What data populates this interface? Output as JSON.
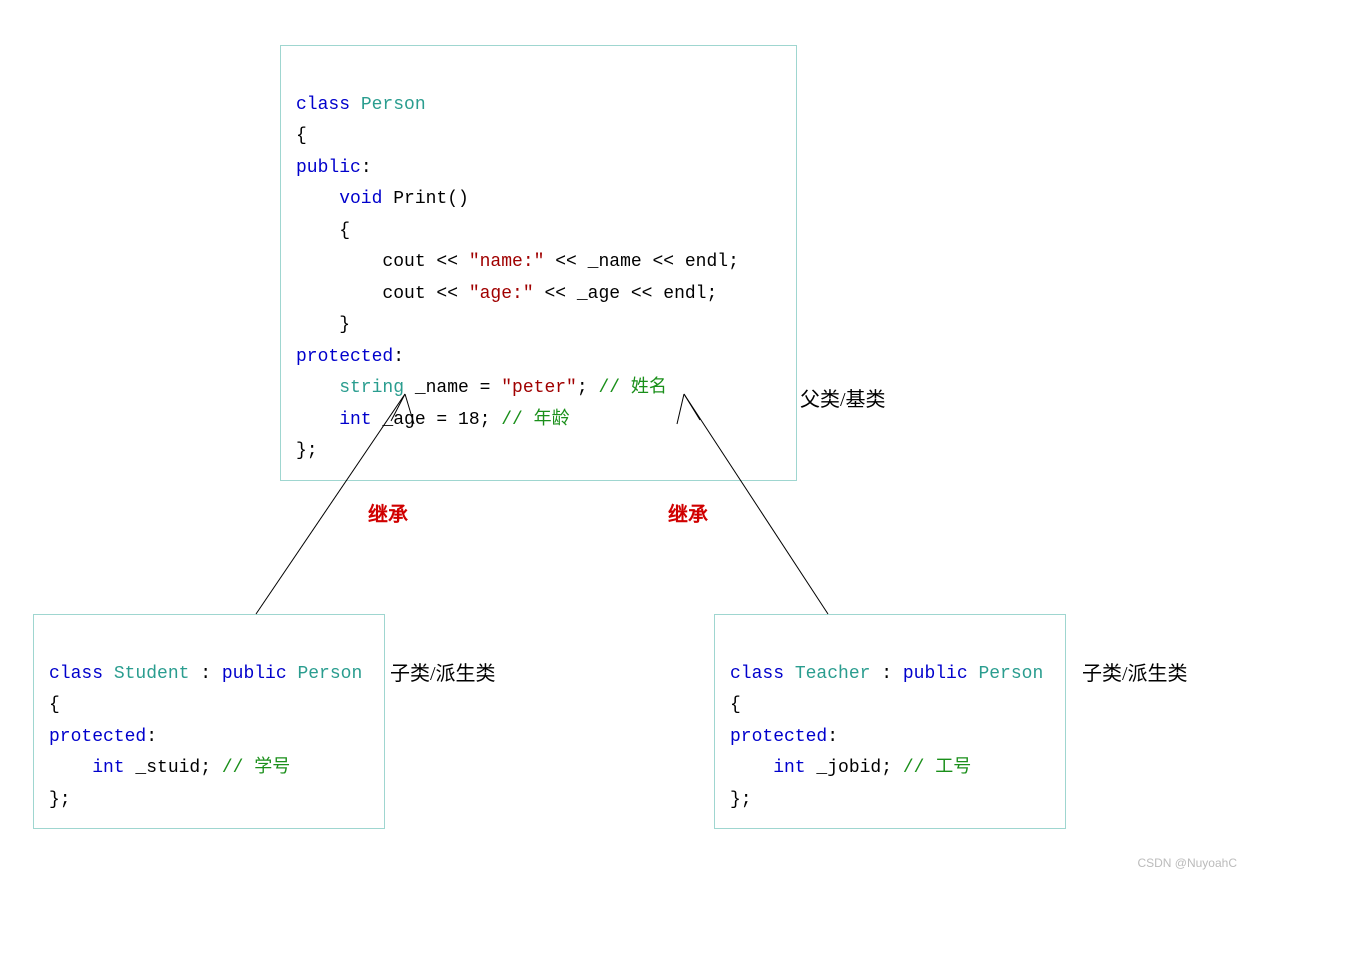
{
  "person": {
    "l1a": "class",
    "l1b": " Person",
    "l2": "{",
    "l3": "public",
    "l3b": ":",
    "l4a": "    void",
    "l4b": " Print()",
    "l5": "    {",
    "l6a": "        cout << ",
    "l6b": "\"name:\"",
    "l6c": " << _name << endl;",
    "l7a": "        cout << ",
    "l7b": "\"age:\"",
    "l7c": " << _age << endl;",
    "l8": "    }",
    "l9": "protected",
    "l9b": ":",
    "l10a": "    string",
    "l10b": " _name = ",
    "l10c": "\"peter\"",
    "l10d": "; ",
    "l10e": "// 姓名",
    "l11a": "    int",
    "l11b": " _age = 18; ",
    "l11c": "// 年龄",
    "l12": "};"
  },
  "student": {
    "l1a": "class",
    "l1b": " Student",
    "l1c": " : ",
    "l1d": "public",
    "l1e": " Person",
    "l2": "{",
    "l3": "protected",
    "l3b": ":",
    "l4a": "    int",
    "l4b": " _stuid; ",
    "l4c": "// 学号",
    "l5": "};"
  },
  "teacher": {
    "l1a": "class",
    "l1b": " Teacher",
    "l1c": " : ",
    "l1d": "public",
    "l1e": " Person",
    "l2": "{",
    "l3": "protected",
    "l3b": ":",
    "l4a": "    int",
    "l4b": " _jobid; ",
    "l4c": "// 工号",
    "l5": "};"
  },
  "labels": {
    "parent": "父类/基类",
    "child1": "子类/派生类",
    "child2": "子类/派生类",
    "inherit1": "继承",
    "inherit2": "继承"
  },
  "watermark": "CSDN @NuyoahC"
}
